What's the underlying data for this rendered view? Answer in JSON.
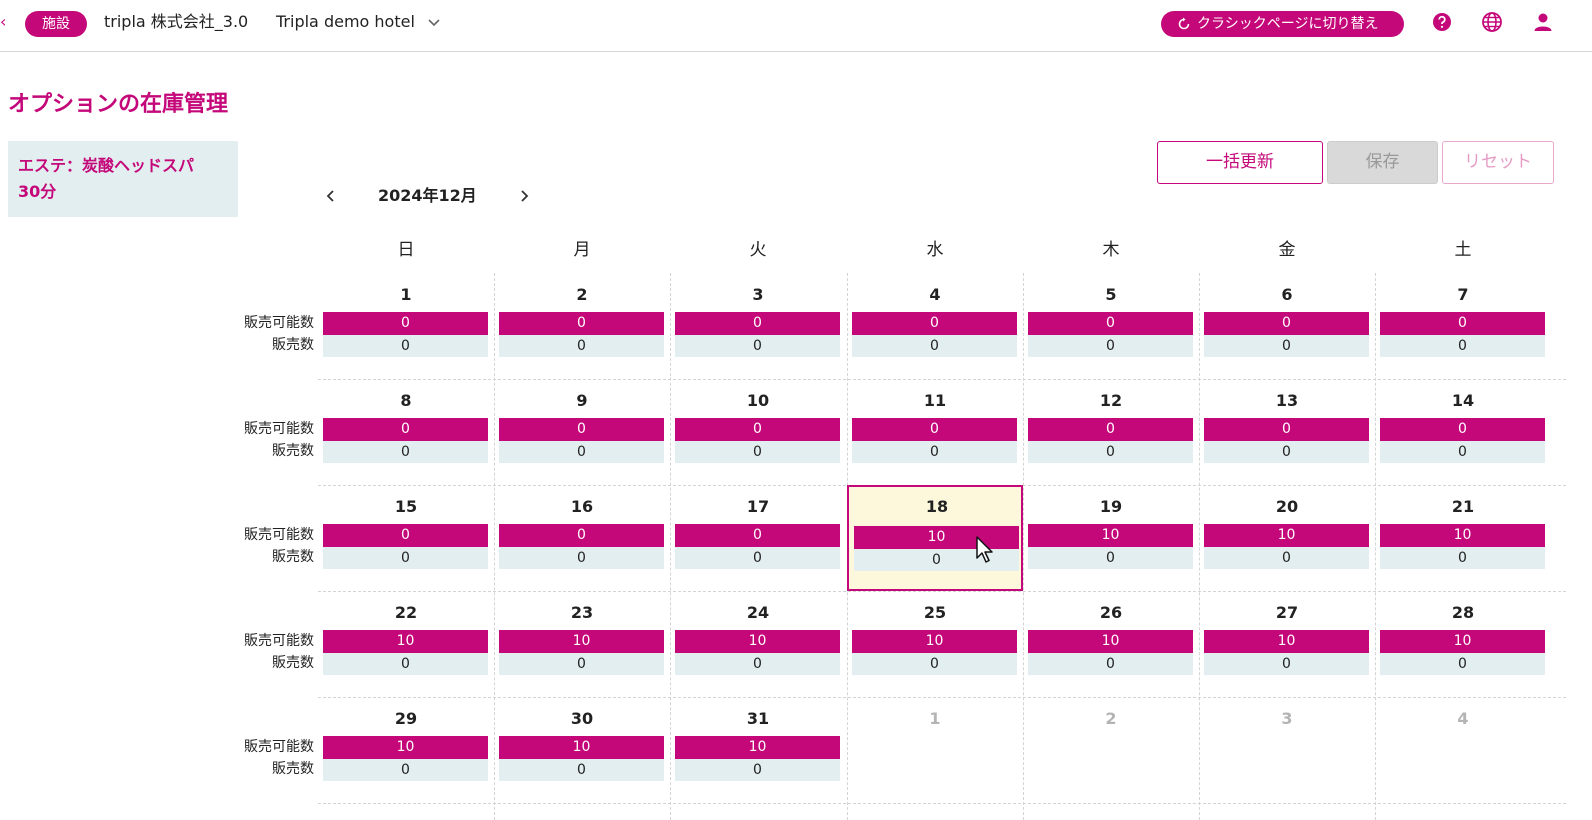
{
  "header": {
    "back_glyph": "‹",
    "facility_badge": "施設",
    "company": "tripla 株式会社_3.0",
    "hotel": "Tripla demo hotel",
    "classic_button": "クラシックページに切り替え",
    "icons": [
      "refresh-icon",
      "help-icon",
      "globe-icon",
      "user-icon"
    ]
  },
  "page_title": "オプションの在庫管理",
  "option": {
    "line1": "エステ：炭酸ヘッドスパ",
    "line2": "30分"
  },
  "actions": {
    "bulk_update": "一括更新",
    "save": "保存",
    "reset": "リセット"
  },
  "calendar": {
    "prev_glyph": "‹",
    "next_glyph": "›",
    "month_label": "2024年12月",
    "weekdays": [
      "日",
      "月",
      "火",
      "水",
      "木",
      "金",
      "土"
    ],
    "label_available": "販売可能数",
    "label_sold": "販売数",
    "selected_day": 18,
    "weeks": [
      [
        {
          "d": "1",
          "a": "0",
          "s": "0"
        },
        {
          "d": "2",
          "a": "0",
          "s": "0"
        },
        {
          "d": "3",
          "a": "0",
          "s": "0"
        },
        {
          "d": "4",
          "a": "0",
          "s": "0"
        },
        {
          "d": "5",
          "a": "0",
          "s": "0"
        },
        {
          "d": "6",
          "a": "0",
          "s": "0"
        },
        {
          "d": "7",
          "a": "0",
          "s": "0"
        }
      ],
      [
        {
          "d": "8",
          "a": "0",
          "s": "0"
        },
        {
          "d": "9",
          "a": "0",
          "s": "0"
        },
        {
          "d": "10",
          "a": "0",
          "s": "0"
        },
        {
          "d": "11",
          "a": "0",
          "s": "0"
        },
        {
          "d": "12",
          "a": "0",
          "s": "0"
        },
        {
          "d": "13",
          "a": "0",
          "s": "0"
        },
        {
          "d": "14",
          "a": "0",
          "s": "0"
        }
      ],
      [
        {
          "d": "15",
          "a": "0",
          "s": "0"
        },
        {
          "d": "16",
          "a": "0",
          "s": "0"
        },
        {
          "d": "17",
          "a": "0",
          "s": "0"
        },
        {
          "d": "18",
          "a": "10",
          "s": "0"
        },
        {
          "d": "19",
          "a": "10",
          "s": "0"
        },
        {
          "d": "20",
          "a": "10",
          "s": "0"
        },
        {
          "d": "21",
          "a": "10",
          "s": "0"
        }
      ],
      [
        {
          "d": "22",
          "a": "10",
          "s": "0"
        },
        {
          "d": "23",
          "a": "10",
          "s": "0"
        },
        {
          "d": "24",
          "a": "10",
          "s": "0"
        },
        {
          "d": "25",
          "a": "10",
          "s": "0"
        },
        {
          "d": "26",
          "a": "10",
          "s": "0"
        },
        {
          "d": "27",
          "a": "10",
          "s": "0"
        },
        {
          "d": "28",
          "a": "10",
          "s": "0"
        }
      ],
      [
        {
          "d": "29",
          "a": "10",
          "s": "0"
        },
        {
          "d": "30",
          "a": "10",
          "s": "0"
        },
        {
          "d": "31",
          "a": "10",
          "s": "0"
        },
        {
          "d": "1",
          "other": true
        },
        {
          "d": "2",
          "other": true
        },
        {
          "d": "3",
          "other": true
        },
        {
          "d": "4",
          "other": true
        }
      ]
    ]
  },
  "colors": {
    "accent": "#c4087a",
    "light_panel": "#e3eef0",
    "selected_bg": "#fdf8dc"
  }
}
